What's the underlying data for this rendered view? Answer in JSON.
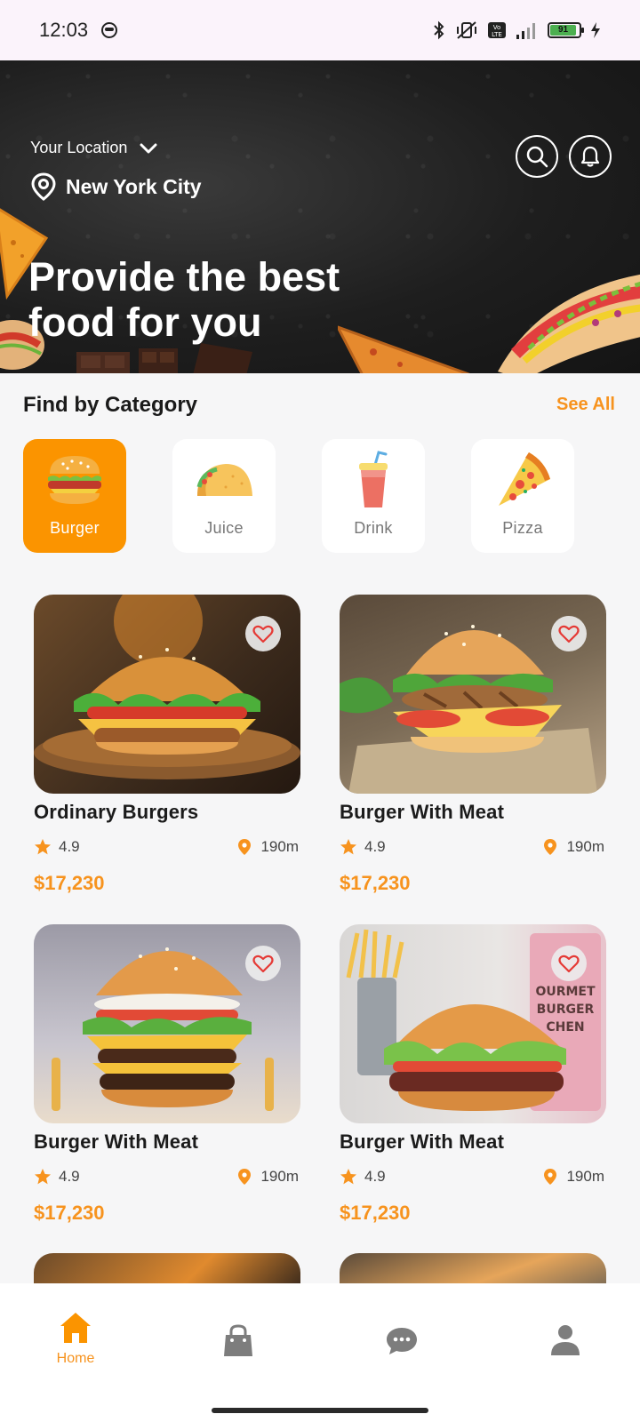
{
  "status_bar": {
    "time": "12:03",
    "battery": "91"
  },
  "header": {
    "location_label": "Your Location",
    "city": "New York City",
    "headline_line1": "Provide the best",
    "headline_line2": "food for you"
  },
  "category": {
    "title": "Find by Category",
    "see_all": "See All",
    "items": [
      {
        "label": "Burger",
        "icon": "burger-icon",
        "active": true
      },
      {
        "label": "Juice",
        "icon": "taco-icon",
        "active": false
      },
      {
        "label": "Drink",
        "icon": "drink-icon",
        "active": false
      },
      {
        "label": "Pizza",
        "icon": "pizza-icon",
        "active": false
      }
    ]
  },
  "foods": [
    {
      "name": "Ordinary Burgers",
      "rating": "4.9",
      "distance": "190m",
      "price": "$17,230"
    },
    {
      "name": "Burger With Meat",
      "rating": "4.9",
      "distance": "190m",
      "price": "$17,230"
    },
    {
      "name": "Burger With Meat",
      "rating": "4.9",
      "distance": "190m",
      "price": "$17,230"
    },
    {
      "name": "Burger With Meat",
      "rating": "4.9",
      "distance": "190m",
      "price": "$17,230"
    }
  ],
  "nav": {
    "home_label": "Home"
  },
  "colors": {
    "accent": "#fb9400",
    "price": "#f7931e"
  }
}
